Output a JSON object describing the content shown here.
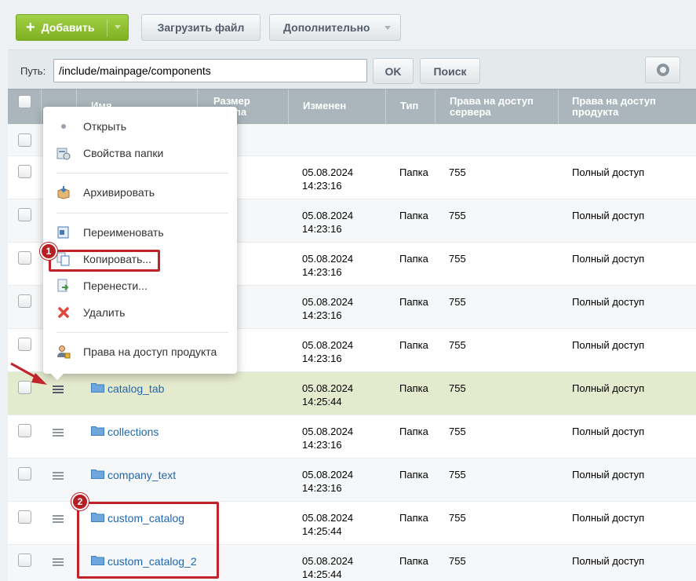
{
  "toolbar": {
    "add_label": "Добавить",
    "upload_label": "Загрузить файл",
    "more_label": "Дополнительно"
  },
  "pathbar": {
    "label": "Путь:",
    "value": "/include/mainpage/components",
    "ok_label": "OK",
    "search_label": "Поиск"
  },
  "table": {
    "columns": {
      "name": "Имя",
      "size": "Размер\nфайла",
      "modified": "Изменен",
      "type": "Тип",
      "server_rights": "Права на доступ\nсервера",
      "product_rights": "Права на доступ\nпродукта"
    },
    "rows": [
      {
        "name": "",
        "date": "05.08.2024 14:23:16",
        "type": "Папка",
        "server": "755",
        "product": "Полный доступ"
      },
      {
        "name": "",
        "date": "05.08.2024 14:23:16",
        "type": "Папка",
        "server": "755",
        "product": "Полный доступ"
      },
      {
        "name": "",
        "date": "05.08.2024 14:23:16",
        "type": "Папка",
        "server": "755",
        "product": "Полный доступ"
      },
      {
        "name": "",
        "date": "05.08.2024 14:23:16",
        "type": "Папка",
        "server": "755",
        "product": "Полный доступ"
      },
      {
        "name": "",
        "date": "05.08.2024 14:23:16",
        "type": "Папка",
        "server": "755",
        "product": "Полный доступ"
      },
      {
        "name": "catalog_tab",
        "date": "05.08.2024 14:25:44",
        "type": "Папка",
        "server": "755",
        "product": "Полный доступ"
      },
      {
        "name": "collections",
        "date": "05.08.2024 14:23:16",
        "type": "Папка",
        "server": "755",
        "product": "Полный доступ"
      },
      {
        "name": "company_text",
        "date": "05.08.2024 14:23:16",
        "type": "Папка",
        "server": "755",
        "product": "Полный доступ"
      },
      {
        "name": "custom_catalog",
        "date": "05.08.2024 14:25:44",
        "type": "Папка",
        "server": "755",
        "product": "Полный доступ"
      },
      {
        "name": "custom_catalog_2",
        "date": "05.08.2024 14:25:44",
        "type": "Папка",
        "server": "755",
        "product": "Полный доступ"
      }
    ]
  },
  "context_menu": {
    "items": [
      {
        "label": "Открыть",
        "icon": "dot-icon"
      },
      {
        "label": "Свойства папки",
        "icon": "folder-properties-icon"
      },
      {
        "label": "Архивировать",
        "icon": "archive-box-icon"
      },
      {
        "label": "Переименовать",
        "icon": "rename-icon"
      },
      {
        "label": "Копировать...",
        "icon": "copy-icon"
      },
      {
        "label": "Перенести...",
        "icon": "move-icon"
      },
      {
        "label": "Удалить",
        "icon": "delete-x-icon"
      },
      {
        "label": "Права на доступ продукта",
        "icon": "user-lock-icon"
      }
    ]
  },
  "annotations": {
    "badge_1": "1",
    "badge_2": "2"
  },
  "colors": {
    "accent_green": "#8bbf2c",
    "header_gray": "#aab6bc",
    "link_blue": "#2067b0",
    "highlight_row": "#e4eacd",
    "annotation_red": "#c0232a"
  }
}
